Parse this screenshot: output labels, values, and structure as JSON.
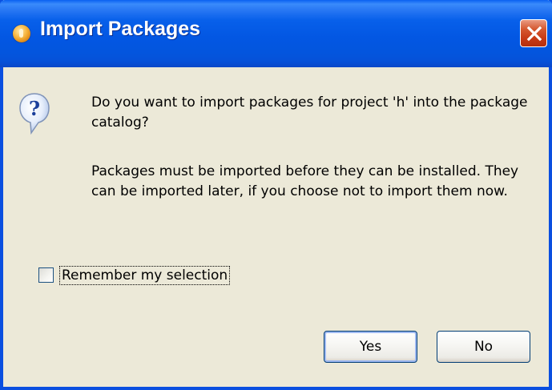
{
  "window": {
    "title": "Import Packages",
    "app_icon": "eclipse-orange-icon",
    "close_icon": "close-x-icon"
  },
  "dialog": {
    "icon": "question-icon",
    "message_line1": "Do you want to import packages for project 'h' into the package catalog?",
    "message_line2": "Packages must be imported before they can be installed. They can be imported later, if you choose not to import them now.",
    "remember_checkbox": {
      "label": "Remember my selection",
      "checked": false
    },
    "buttons": {
      "yes_label": "Yes",
      "no_label": "No"
    }
  },
  "colors": {
    "titlebar": "#0355DD",
    "window_bg": "#ECE9D8",
    "close_button": "#C73A14",
    "border": "#0A4FE0"
  }
}
